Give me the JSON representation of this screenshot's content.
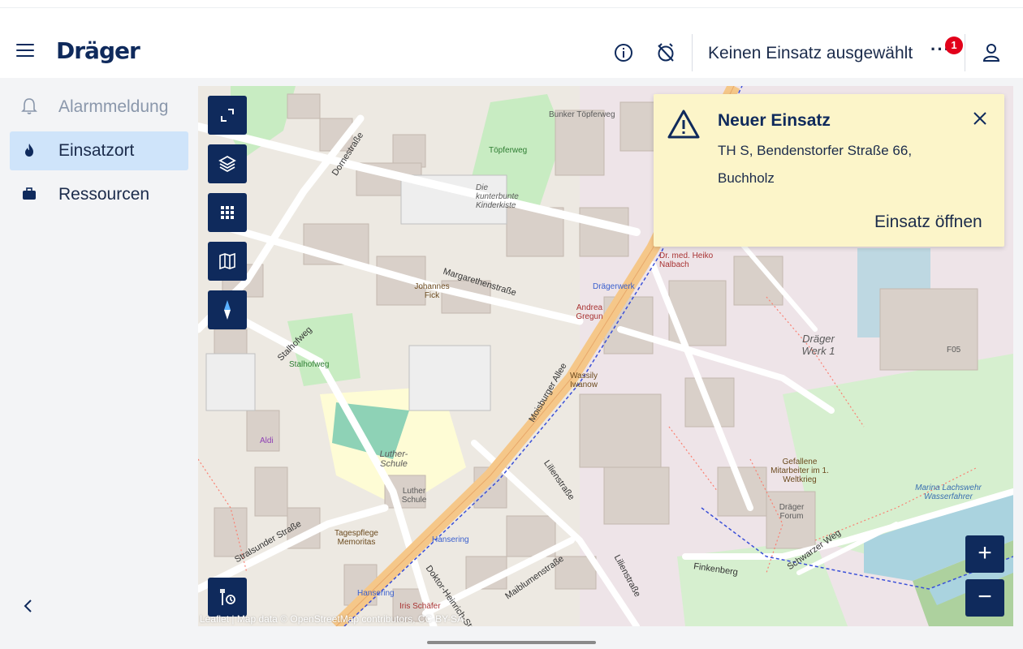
{
  "header": {
    "logo": "Dräger",
    "mission_status": "Keinen Einsatz ausgewählt",
    "more_label": "···",
    "notification_count": "1",
    "icons": [
      "menu-icon",
      "info-icon",
      "alarm-off-icon",
      "more-icon",
      "user-icon"
    ]
  },
  "sidebar": {
    "items": [
      {
        "label": "Alarmmeldung",
        "icon": "bell-icon",
        "state": "disabled"
      },
      {
        "label": "Einsatzort",
        "icon": "flame-icon",
        "state": "active"
      },
      {
        "label": "Ressourcen",
        "icon": "briefcase-icon",
        "state": "normal"
      }
    ],
    "collapse_icon": "chevron-left-icon"
  },
  "map": {
    "attribution": "Leaflet | Map data © OpenStreetMap contributors, CC-BY-SA",
    "controls": [
      "fullscreen-icon",
      "layers-icon",
      "grid-icon",
      "map-icon",
      "compass-icon",
      "tools-icon"
    ],
    "zoom_in": "+",
    "zoom_out": "−",
    "streets": {
      "margarethenstrasse": "Margarethenstraße",
      "moisburger_allee": "Moisburger Allee",
      "dornestrasse": "Dornestraße",
      "stalhofweg": "Stalhofweg",
      "stralsunder_strasse": "Stralsunder Straße",
      "lilienstrasse": "Lilienstraße",
      "maiblumenstrasse": "Maiblumenstraße",
      "finkenberg": "Finkenberg",
      "schwarzer_weg": "Schwarzer Weg",
      "doktor_heinrich": "Doktor-Heinrich-Str."
    },
    "places": {
      "bunker": "Bunker Töpferweg",
      "topferweg": "Töpferweg",
      "kinderkiste": "Die kunterbunte Kinderkiste",
      "johannes": "Johannes Fick",
      "andrea": "Andrea Gregun",
      "draegerwerk": "Drägerwerk",
      "dr_nalbach": "Dr. med. Heiko Nalbach",
      "wassily": "Wassily Iwanow",
      "luther_schule": "Luther-Schule",
      "luther_schule2": "Luther Schule",
      "aldi": "Aldi",
      "stalhofweg_park": "Stalhofweg",
      "tagespflege": "Tagespflege Memoritas",
      "hansering": "Hansering",
      "iris": "Iris Schäfer",
      "gefallene": "Gefallene Mitarbeiter im 1. Weltkrieg",
      "draeger_forum": "Dräger Forum",
      "draeger_werk1": "Dräger Werk 1",
      "marina": "Marina Lachswehr Wasserfahrer",
      "f05": "F05"
    }
  },
  "popup": {
    "title": "Neuer Einsatz",
    "address_line1": "TH S, Bendenstorfer Straße 66,",
    "address_line2": "Buchholz",
    "open_label": "Einsatz öffnen",
    "background_color": "#fcf5c9"
  },
  "colors": {
    "brand": "#0f2a5c",
    "active_nav": "#cfe4fa",
    "badge": "#e2001a"
  }
}
